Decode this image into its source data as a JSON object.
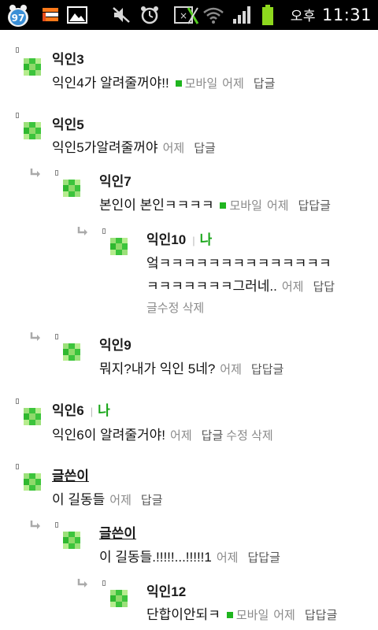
{
  "status_bar": {
    "notification_badge": "97",
    "ampm": "오후",
    "time": "11:31"
  },
  "comments": [
    {
      "name": "익인3",
      "text": "익인4가 알려줄꺼야!!",
      "mobile": "모바일",
      "date": "어제",
      "reply": "답글"
    },
    {
      "name": "익인5",
      "text": "익인5가알려줄꺼야",
      "date": "어제",
      "reply": "답글"
    },
    {
      "name": "익인7",
      "text": "본인이 본인ㅋㅋㅋㅋ",
      "mobile": "모바일",
      "date": "어제",
      "reply": "답답글"
    },
    {
      "name": "익인10",
      "me": "나",
      "text_line1": "엌ㅋㅋㅋㅋㅋㅋㅋㅋㅋㅋㅋㅋㅋㅋ",
      "text_line2": "ㅋㅋㅋㅋㅋㅋㅋ그러네..",
      "date": "어제",
      "reply": "답답",
      "actions": "글수정 삭제"
    },
    {
      "name": "익인9",
      "text": "뭐지?내가 익인 5네?",
      "date": "어제",
      "reply": "답답글"
    },
    {
      "name": "익인6",
      "me": "나",
      "text": "익인6이 알려줄거야!",
      "date": "어제",
      "reply": "답글",
      "actions": "수정 삭제"
    },
    {
      "name": "글쓴이",
      "text": "이 길동들",
      "date": "어제",
      "reply": "답글"
    },
    {
      "name": "글쓴이",
      "text": "이 길동들.!!!!!...!!!!!1",
      "date": "어제",
      "reply": "답답글"
    },
    {
      "name": "익인12",
      "text": "단합이안되ㅋ",
      "mobile": "모바일",
      "date": "어제",
      "reply": "답답글"
    }
  ],
  "colors": {
    "accent_green": "#1aa61a",
    "meta_gray": "#8a8a8a"
  },
  "icons": [
    "talk-badge-icon",
    "sim-icon",
    "gallery-icon",
    "mute-icon",
    "alarm-icon",
    "data-sync-icon",
    "wifi-icon",
    "signal-icon",
    "battery-icon",
    "reply-arrow-icon",
    "avatar-pixel-icon"
  ]
}
